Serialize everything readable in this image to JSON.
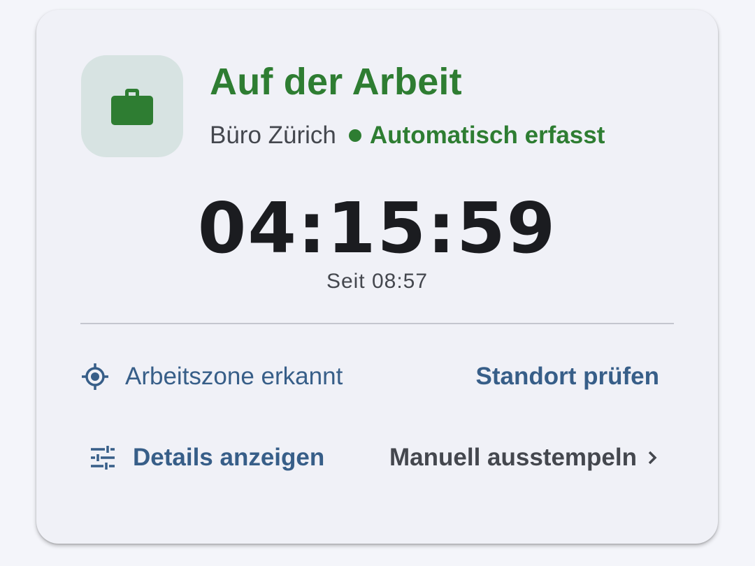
{
  "status": {
    "title": "Auf der Arbeit",
    "location": "Büro Zürich",
    "tracking": "Automatisch erfasst",
    "icon": "briefcase-icon"
  },
  "timer": {
    "elapsed": "04:15:59",
    "since": "Seit 08:57"
  },
  "zone": {
    "label": "Arbeitszone erkannt",
    "icon": "gps-target-icon",
    "action": "Standort prüfen"
  },
  "actions": {
    "details": "Details anzeigen",
    "details_icon": "tune-icon",
    "clock_out": "Manuell ausstempeln",
    "clock_out_icon": "chevron-right-icon"
  },
  "colors": {
    "accent_green": "#2e7d32",
    "accent_blue": "#375e88",
    "icon_bg": "#d7e3e2"
  }
}
